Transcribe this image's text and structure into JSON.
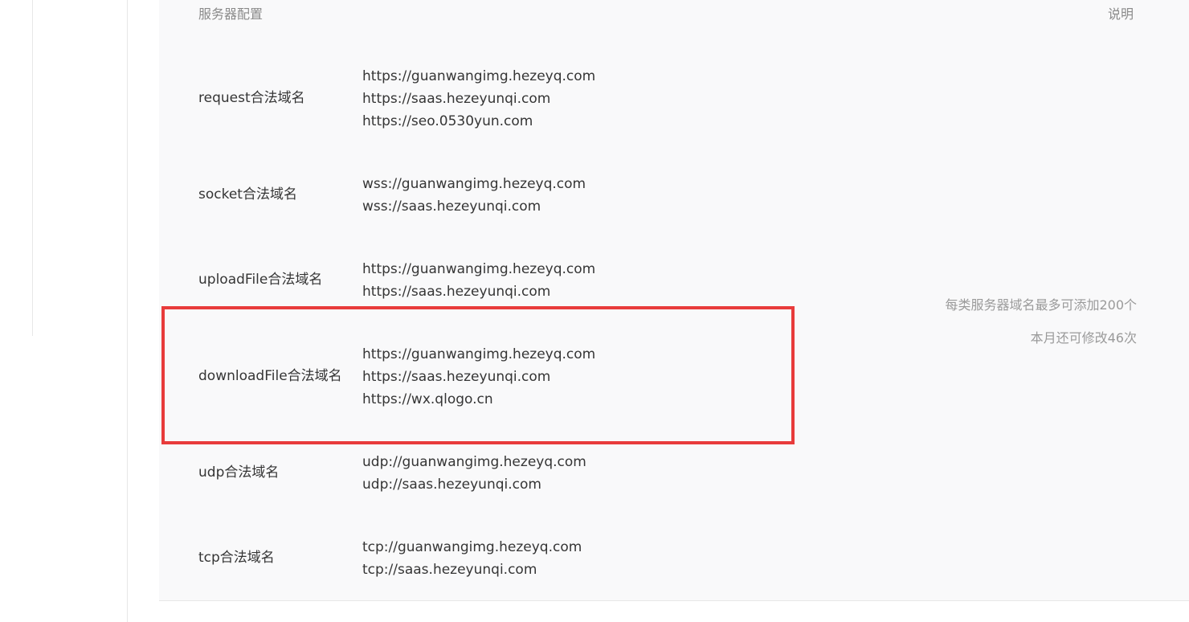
{
  "header": {
    "left": "服务器配置",
    "right": "说明"
  },
  "rows": [
    {
      "label": "request合法域名",
      "domains": [
        "https://guanwangimg.hezeyq.com",
        "https://saas.hezeyunqi.com",
        "https://seo.0530yun.com"
      ]
    },
    {
      "label": "socket合法域名",
      "domains": [
        "wss://guanwangimg.hezeyq.com",
        "wss://saas.hezeyunqi.com"
      ]
    },
    {
      "label": "uploadFile合法域名",
      "domains": [
        "https://guanwangimg.hezeyq.com",
        "https://saas.hezeyunqi.com"
      ]
    },
    {
      "label": "downloadFile合法域名",
      "domains": [
        "https://guanwangimg.hezeyq.com",
        "https://saas.hezeyunqi.com",
        "https://wx.qlogo.cn"
      ]
    },
    {
      "label": "udp合法域名",
      "domains": [
        "udp://guanwangimg.hezeyq.com",
        "udp://saas.hezeyunqi.com"
      ]
    },
    {
      "label": "tcp合法域名",
      "domains": [
        "tcp://guanwangimg.hezeyq.com",
        "tcp://saas.hezeyunqi.com"
      ]
    }
  ],
  "notes": [
    "每类服务器域名最多可添加200个",
    "本月还可修改46次"
  ],
  "colors": {
    "highlight": "#e83b3b",
    "panel": "#f9f9fa",
    "text": "#353535",
    "muted": "#8a8a8a"
  }
}
